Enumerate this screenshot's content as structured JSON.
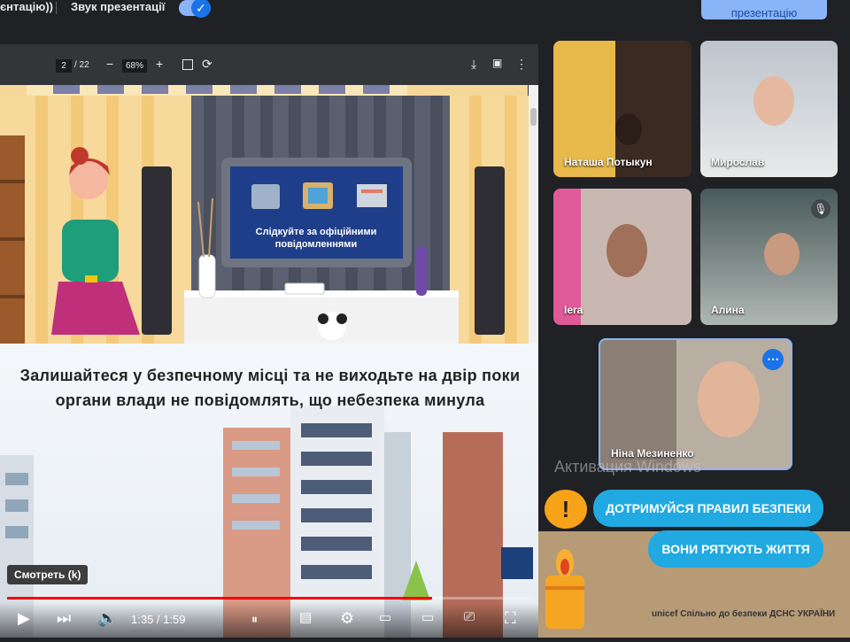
{
  "topbar": {
    "left_text": "єнтацію))",
    "sound_label": "Звук презентації",
    "present_button": "презентацію",
    "toggle_check": "✓"
  },
  "pdf": {
    "page": "2",
    "total": "/ 22",
    "zoom": "68%",
    "minus": "−",
    "plus": "+"
  },
  "slide": {
    "tv_text": "Слідкуйте за офіційними повідомленнями",
    "caption": "Залишайтеся у безпечному місці та не виходьте на двір поки органи влади не повідомлять, що небезпека минула"
  },
  "video": {
    "watch_label": "Смотреть (k)",
    "time": "1:35 / 1:59",
    "progress": 0.81
  },
  "participants": [
    {
      "name": "Наташа Потыкун"
    },
    {
      "name": "Мирослав"
    },
    {
      "name": "Iera"
    },
    {
      "name": "Алина"
    },
    {
      "name": "Ніна Мезиненко"
    }
  ],
  "overlay": {
    "activate": "Активация Windows",
    "banner1": "ДОТРИМУЙСЯ ПРАВИЛ БЕЗПЕКИ",
    "banner2": "ВОНИ РЯТУЮТЬ ЖИТТЯ",
    "warn_symbol": "!",
    "logos": "unicef  Спільно до безпеки   ДСНС УКРАЇНИ"
  }
}
